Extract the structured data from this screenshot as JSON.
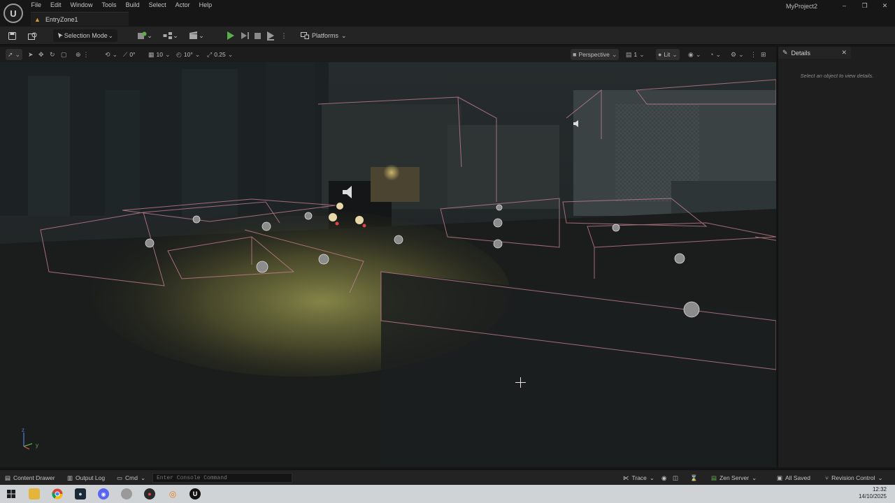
{
  "window": {
    "project_name": "MyProject2",
    "logo_text": "U",
    "menu": [
      "File",
      "Edit",
      "Window",
      "Tools",
      "Build",
      "Select",
      "Actor",
      "Help"
    ],
    "level_tab": "EntryZone1",
    "controls": [
      "–",
      "❐",
      "✕"
    ]
  },
  "toolbar": {
    "selection_mode": "Selection Mode",
    "platforms": "Platforms"
  },
  "viewport_toolbar": {
    "rotate_value": "0°",
    "grid_value": "10",
    "rotation_snap": "10°",
    "scale_snap": "0.25",
    "view_mode": "Perspective",
    "camera_speed": "1",
    "lighting_mode": "Lit"
  },
  "viewport": {
    "axis_z": "z",
    "axis_y": "y"
  },
  "details": {
    "tab_label": "Details",
    "empty_message": "Select an object to view details."
  },
  "statusbar": {
    "content_drawer": "Content Drawer",
    "output_log": "Output Log",
    "cmd": "Cmd",
    "console_placeholder": "Enter Console Command",
    "trace": "Trace",
    "zen_server": "Zen Server",
    "all_saved": "All Saved",
    "revision_control": "Revision Control"
  },
  "taskbar": {
    "time": "12:32",
    "date": "14/10/2025"
  },
  "colors": {
    "play_green": "#59b04a",
    "accent_orange": "#d89b35",
    "volume_wire": "#c47f8f"
  }
}
